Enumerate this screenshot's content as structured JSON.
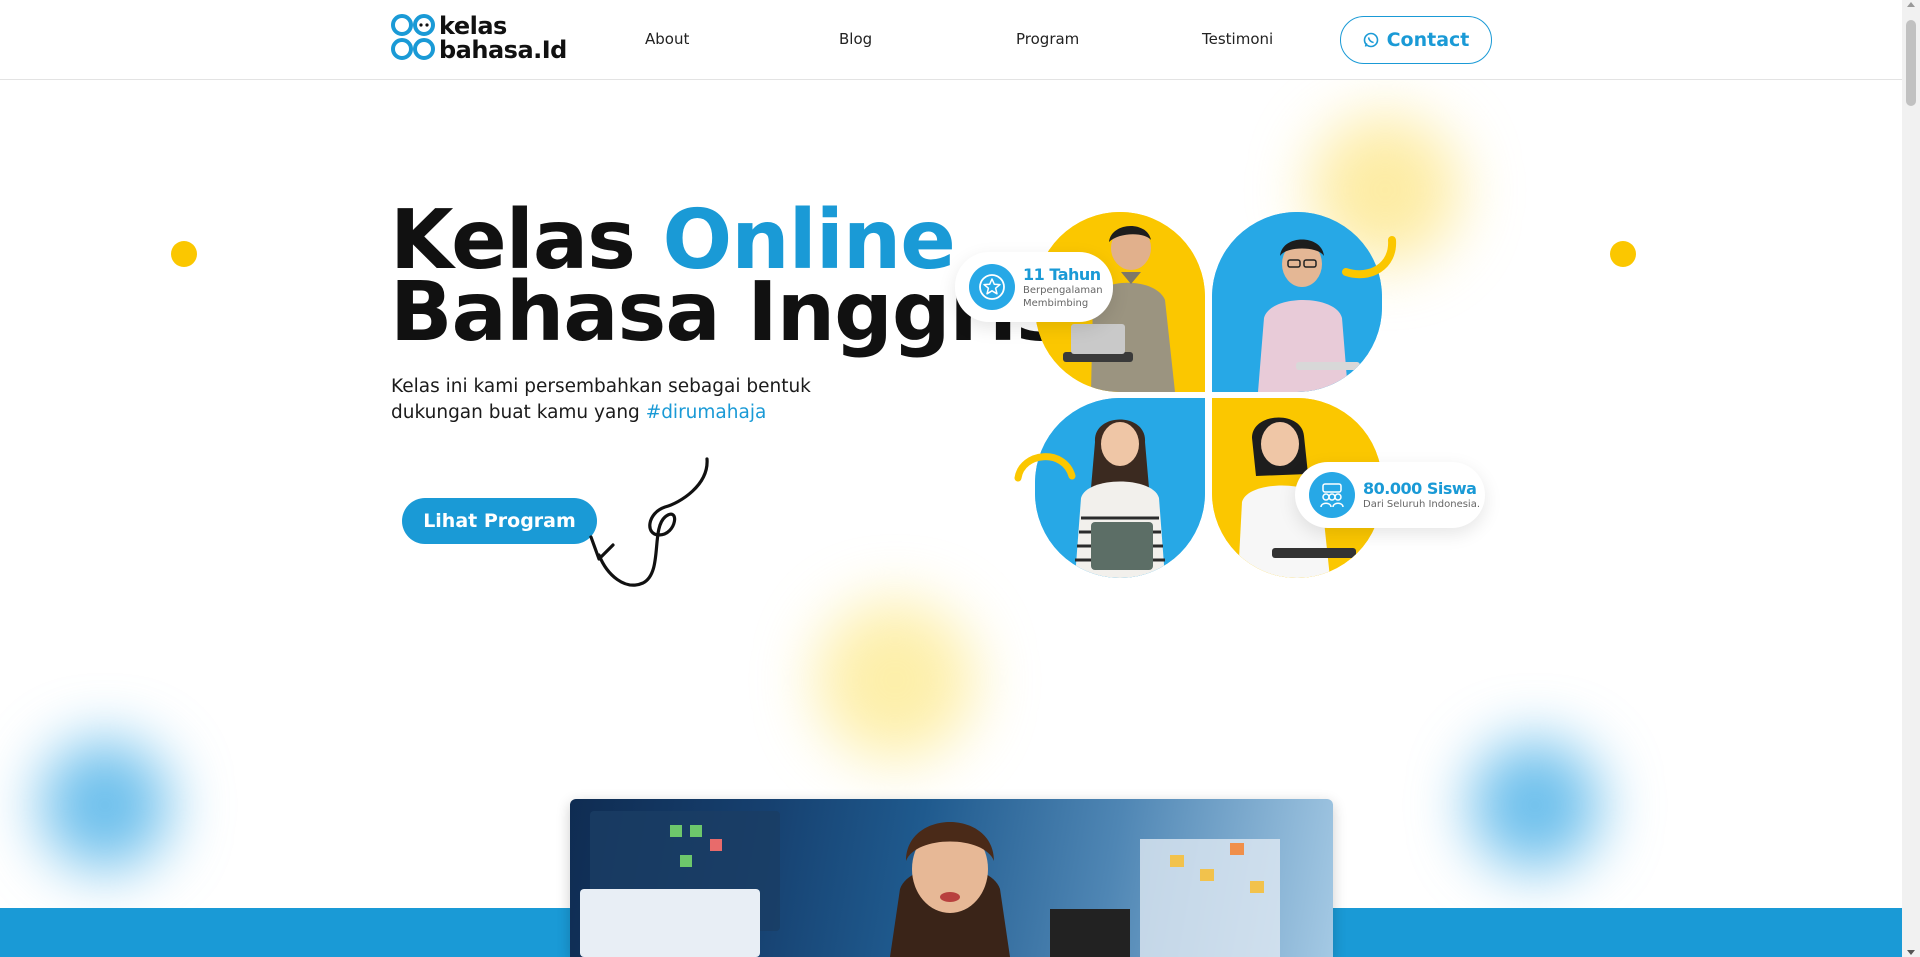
{
  "brand": {
    "logo_line1": "kelas",
    "logo_line2": "bahasa.Id"
  },
  "nav": {
    "items": [
      {
        "label": "About"
      },
      {
        "label": "Blog"
      },
      {
        "label": "Program"
      },
      {
        "label": "Testimoni"
      }
    ],
    "contact_label": "Contact"
  },
  "hero": {
    "title_part1": "Kelas ",
    "title_accent": "Online",
    "title_line2": "Bahasa Inggris",
    "subtitle": "Kelas ini kami persembahkan sebagai bentuk dukungan buat kamu yang ",
    "hashtag": "#dirumahaja",
    "cta_label": "Lihat Program"
  },
  "badges": {
    "experience": {
      "title": "11 Tahun",
      "line1": "Berpengalaman",
      "line2": "Membimbing",
      "icon": "star-badge-icon"
    },
    "students": {
      "title": "80.000 Siswa",
      "line1": "Dari Seluruh Indonesia.",
      "icon": "group-icon"
    }
  },
  "colors": {
    "accent": "#1a9ad6",
    "yellow": "#fbc700",
    "text": "#111111"
  }
}
